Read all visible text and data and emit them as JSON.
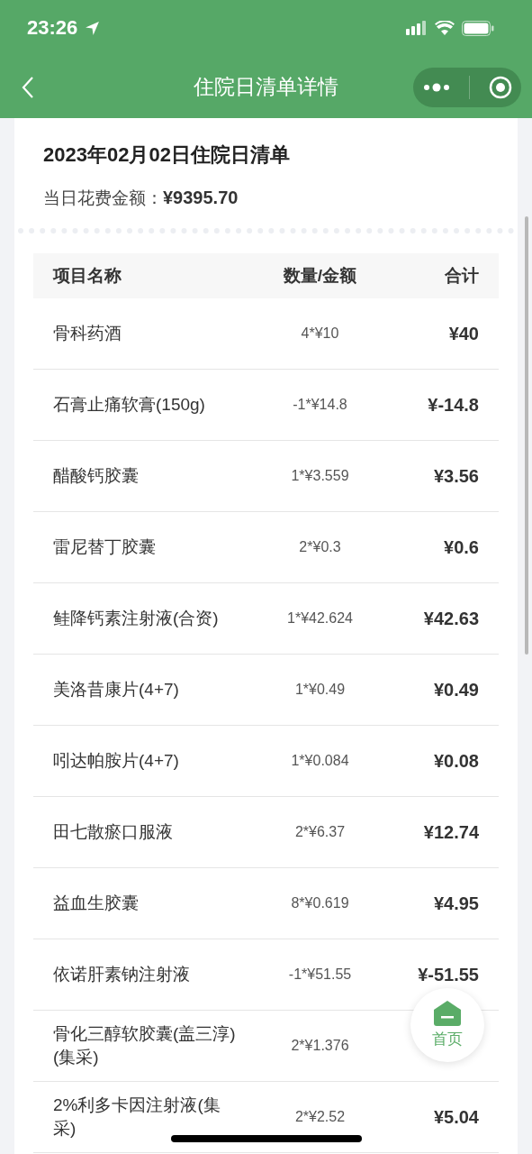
{
  "status_bar": {
    "time": "23:26"
  },
  "nav": {
    "title": "住院日清单详情"
  },
  "summary": {
    "title": "2023年02月02日住院日清单",
    "amount_label": "当日花费金额：",
    "amount": "¥9395.70"
  },
  "table": {
    "columns": [
      "项目名称",
      "数量/金额",
      "合计"
    ],
    "rows": [
      {
        "name": "骨科药酒",
        "qty": "4*¥10",
        "total": "¥40"
      },
      {
        "name": "石膏止痛软膏(150g)",
        "qty": "-1*¥14.8",
        "total": "¥-14.8"
      },
      {
        "name": "醋酸钙胶囊",
        "qty": "1*¥3.559",
        "total": "¥3.56"
      },
      {
        "name": "雷尼替丁胶囊",
        "qty": "2*¥0.3",
        "total": "¥0.6"
      },
      {
        "name": "鲑降钙素注射液(合资)",
        "qty": "1*¥42.624",
        "total": "¥42.63"
      },
      {
        "name": "美洛昔康片(4+7)",
        "qty": "1*¥0.49",
        "total": "¥0.49"
      },
      {
        "name": "吲达帕胺片(4+7)",
        "qty": "1*¥0.084",
        "total": "¥0.08"
      },
      {
        "name": "田七散瘀口服液",
        "qty": "2*¥6.37",
        "total": "¥12.74"
      },
      {
        "name": "益血生胶囊",
        "qty": "8*¥0.619",
        "total": "¥4.95"
      },
      {
        "name": "依诺肝素钠注射液",
        "qty": "-1*¥51.55",
        "total": "¥-51.55"
      },
      {
        "name": "骨化三醇软胶囊(盖三淳)(集采)",
        "qty": "2*¥1.376"
      },
      {
        "name": "2%利多卡因注射液(集采)",
        "qty": "2*¥2.52",
        "total": "¥5.04"
      }
    ]
  },
  "home_button": {
    "label": "首页"
  }
}
